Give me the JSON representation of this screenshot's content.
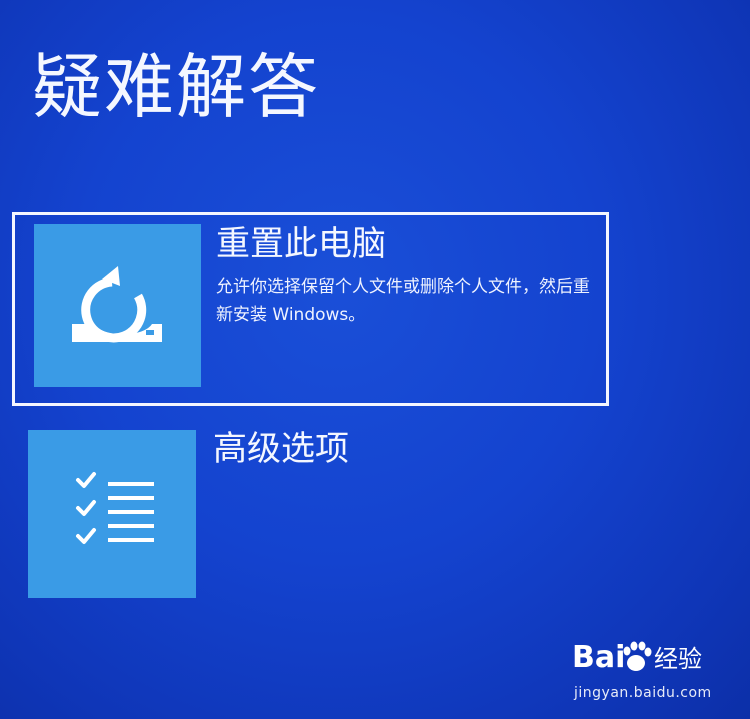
{
  "page": {
    "title": "疑难解答"
  },
  "options": {
    "reset": {
      "icon": "reset-pc-icon",
      "title": "重置此电脑",
      "description": "允许你选择保留个人文件或删除个人文件，然后重新安装 Windows。"
    },
    "advanced": {
      "icon": "checklist-icon",
      "title": "高级选项"
    }
  },
  "watermark": {
    "logo_text": "Bai经验",
    "url": "jingyan.baidu.com"
  },
  "colors": {
    "background": "#1443cf",
    "tile": "#3a9be6",
    "text": "#ffffff",
    "selection_border": "#f4f6ff"
  }
}
